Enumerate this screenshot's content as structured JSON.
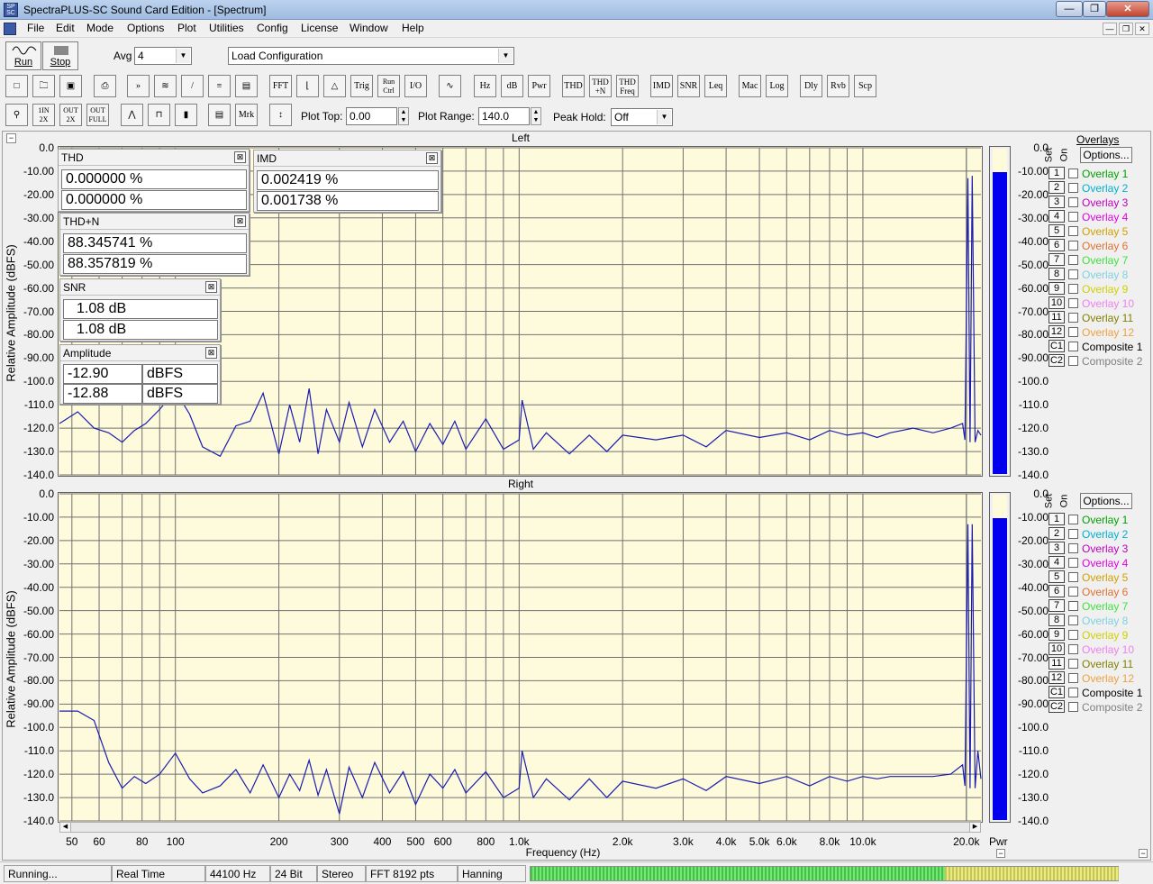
{
  "window": {
    "title": "SpectraPLUS-SC Sound Card Edition - [Spectrum]"
  },
  "menu": [
    "File",
    "Edit",
    "Mode",
    "Options",
    "Plot",
    "Utilities",
    "Config",
    "License",
    "Window",
    "Help"
  ],
  "toolbar1": {
    "run": "Run",
    "stop": "Stop",
    "avg_label": "Avg",
    "avg_value": "4",
    "config_value": "Load Configuration"
  },
  "toolbar2": [
    "FFT",
    "Trig",
    "Run Ctrl",
    "I/O",
    "Hz",
    "dB",
    "Pwr",
    "THD",
    "THD +N",
    "THD Freq",
    "IMD",
    "SNR",
    "Leq",
    "Mac",
    "Log",
    "Dly",
    "Rvb",
    "Scp"
  ],
  "toolbar3": {
    "buttons": [
      "1IN 2X",
      "OUT 2X",
      "OUT FULL",
      "Mrk"
    ],
    "plot_top_label": "Plot Top:",
    "plot_top_value": "0.00",
    "plot_range_label": "Plot Range:",
    "plot_range_value": "140.0",
    "peak_hold_label": "Peak Hold:",
    "peak_hold_value": "Off"
  },
  "plots": {
    "left_title": "Left",
    "right_title": "Right",
    "ylabel": "Relative Amplitude (dBFS)",
    "xlabel": "Frequency (Hz)",
    "y_ticks": [
      "0.0",
      "-10.00",
      "-20.00",
      "-30.00",
      "-40.00",
      "-50.00",
      "-60.00",
      "-70.00",
      "-80.00",
      "-90.00",
      "-100.0",
      "-110.0",
      "-120.0",
      "-130.0",
      "-140.0"
    ],
    "x_ticks": [
      "50",
      "60",
      "80",
      "100",
      "200",
      "300",
      "400",
      "500",
      "600",
      "800",
      "1.0k",
      "2.0k",
      "3.0k",
      "4.0k",
      "5.0k",
      "6.0k",
      "8.0k",
      "10.0k",
      "20.0k"
    ],
    "meter_label": "Pwr"
  },
  "chart_data": [
    {
      "type": "line",
      "title": "Left",
      "xlabel": "Frequency (Hz)",
      "ylabel": "Relative Amplitude (dBFS)",
      "xscale": "log",
      "xlim": [
        46,
        22050
      ],
      "ylim": [
        -140,
        0
      ],
      "grid": true,
      "x": [
        46,
        52,
        58,
        64,
        70,
        76,
        82,
        90,
        100,
        110,
        120,
        135,
        150,
        165,
        180,
        200,
        215,
        230,
        245,
        260,
        275,
        300,
        320,
        350,
        380,
        420,
        460,
        500,
        550,
        600,
        650,
        700,
        800,
        900,
        1000,
        1020,
        1100,
        1200,
        1400,
        1600,
        1800,
        2000,
        2500,
        3000,
        3500,
        4000,
        5000,
        6000,
        7000,
        8000,
        9000,
        10000,
        11000,
        12000,
        14000,
        16000,
        18000,
        19500,
        19800,
        20200,
        20500,
        20800,
        21200,
        21600,
        22050
      ],
      "y": [
        -118,
        -113,
        -120,
        -122,
        -126,
        -121,
        -118,
        -112,
        -104,
        -114,
        -128,
        -132,
        -119,
        -117,
        -105,
        -131,
        -110,
        -126,
        -103,
        -131,
        -112,
        -126,
        -109,
        -128,
        -112,
        -126,
        -117,
        -130,
        -118,
        -127,
        -117,
        -129,
        -116,
        -129,
        -125,
        -108,
        -129,
        -122,
        -131,
        -123,
        -130,
        -123,
        -125,
        -123,
        -128,
        -121,
        -124,
        -122,
        -125,
        -121,
        -123,
        -122,
        -124,
        -122,
        -120,
        -122,
        -120,
        -118,
        -125,
        -13,
        -126,
        -12,
        -126,
        -121,
        -123
      ]
    },
    {
      "type": "line",
      "title": "Right",
      "xlabel": "Frequency (Hz)",
      "ylabel": "Relative Amplitude (dBFS)",
      "xscale": "log",
      "xlim": [
        46,
        22050
      ],
      "ylim": [
        -140,
        0
      ],
      "grid": true,
      "x": [
        46,
        52,
        58,
        64,
        70,
        76,
        82,
        90,
        100,
        110,
        120,
        135,
        150,
        165,
        180,
        200,
        215,
        230,
        245,
        260,
        275,
        300,
        320,
        350,
        380,
        420,
        460,
        500,
        550,
        600,
        650,
        700,
        800,
        900,
        1000,
        1020,
        1100,
        1200,
        1400,
        1600,
        1800,
        2000,
        2500,
        3000,
        3500,
        4000,
        5000,
        6000,
        7000,
        8000,
        9000,
        10000,
        11000,
        12000,
        14000,
        16000,
        18000,
        19500,
        19800,
        20200,
        20500,
        20800,
        21200,
        21600,
        22050
      ],
      "y": [
        -93,
        -93,
        -97,
        -115,
        -126,
        -121,
        -124,
        -120,
        -111,
        -122,
        -128,
        -125,
        -118,
        -128,
        -116,
        -130,
        -120,
        -127,
        -114,
        -129,
        -118,
        -137,
        -117,
        -130,
        -115,
        -128,
        -119,
        -133,
        -120,
        -126,
        -118,
        -128,
        -119,
        -130,
        -126,
        -110,
        -130,
        -122,
        -131,
        -122,
        -130,
        -123,
        -126,
        -122,
        -127,
        -121,
        -124,
        -121,
        -125,
        -121,
        -123,
        -121,
        -122,
        -121,
        -121,
        -121,
        -120,
        -116,
        -125,
        -13,
        -126,
        -13,
        -126,
        -110,
        -122
      ]
    }
  ],
  "meters": {
    "left_level": -10,
    "right_level": -10,
    "min": -140,
    "max": 0
  },
  "overlays": {
    "header": "Overlays",
    "set_label": "Set",
    "on_label": "On",
    "options_label": "Options...",
    "items": [
      {
        "set": "1",
        "name": "Overlay 1",
        "color": "#00a000"
      },
      {
        "set": "2",
        "name": "Overlay 2",
        "color": "#00b0d0"
      },
      {
        "set": "3",
        "name": "Overlay 3",
        "color": "#c000c0"
      },
      {
        "set": "4",
        "name": "Overlay 4",
        "color": "#e000e0"
      },
      {
        "set": "5",
        "name": "Overlay 5",
        "color": "#d0a000"
      },
      {
        "set": "6",
        "name": "Overlay 6",
        "color": "#e07030"
      },
      {
        "set": "7",
        "name": "Overlay 7",
        "color": "#40e040"
      },
      {
        "set": "8",
        "name": "Overlay 8",
        "color": "#80d0e0"
      },
      {
        "set": "9",
        "name": "Overlay 9",
        "color": "#d0d000"
      },
      {
        "set": "10",
        "name": "Overlay 10",
        "color": "#f080f0"
      },
      {
        "set": "11",
        "name": "Overlay 11",
        "color": "#808000"
      },
      {
        "set": "12",
        "name": "Overlay 12",
        "color": "#f0a040"
      },
      {
        "set": "C1",
        "name": "Composite 1",
        "color": "#000000"
      },
      {
        "set": "C2",
        "name": "Composite 2",
        "color": "#808080"
      }
    ]
  },
  "meter_windows": {
    "thd": {
      "title": "THD",
      "v1": "0.000000 %",
      "v2": "0.000000 %"
    },
    "imd": {
      "title": "IMD",
      "v1": "0.002419 %",
      "v2": "0.001738 %"
    },
    "thdn": {
      "title": "THD+N",
      "v1": "88.345741 %",
      "v2": "88.357819 %"
    },
    "snr": {
      "title": "SNR",
      "v1": "1.08 dB",
      "v2": "1.08 dB"
    },
    "amplitude": {
      "title": "Amplitude",
      "v1": "-12.90",
      "v1u": "dBFS",
      "v2": "-12.88",
      "v2u": "dBFS"
    }
  },
  "status": {
    "state": "Running...",
    "mode": "Real Time",
    "rate": "44100 Hz",
    "bits": "24 Bit",
    "channels": "Stereo",
    "fft": "FFT 8192 pts",
    "window": "Hanning"
  }
}
